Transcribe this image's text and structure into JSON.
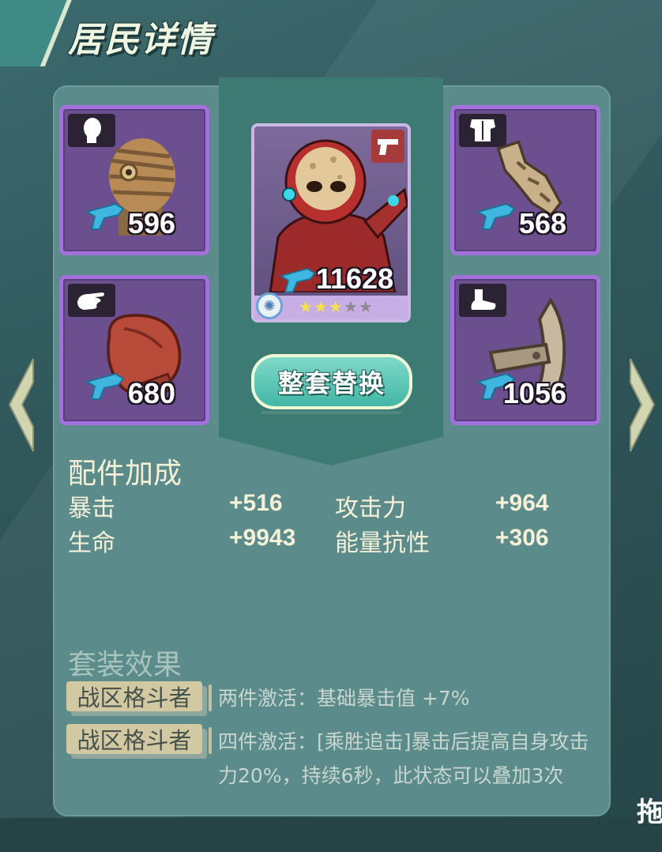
{
  "header": {
    "title": "居民详情"
  },
  "equipment": {
    "head": {
      "type_icon": "head-silhouette-icon",
      "item": "bandaged-mask-helmet",
      "power": "596"
    },
    "body": {
      "type_icon": "torso-icon",
      "item": "segmented-bone-armor",
      "power": "568"
    },
    "hand": {
      "type_icon": "hand-icon",
      "item": "red-boxing-glove",
      "power": "680"
    },
    "foot": {
      "type_icon": "foot-icon",
      "item": "iron-leg-guard",
      "power": "1056"
    }
  },
  "hero": {
    "power": "11628",
    "class_icon": "pistol-icon",
    "stars_filled": 3,
    "stars_total": 5
  },
  "replace_button": {
    "label": "整套替换"
  },
  "bonus": {
    "title": "配件加成",
    "stats": [
      {
        "name": "暴击",
        "value": "+516"
      },
      {
        "name": "攻击力",
        "value": "+964"
      },
      {
        "name": "生命",
        "value": "+9943"
      },
      {
        "name": "能量抗性",
        "value": "+306"
      }
    ]
  },
  "set_effects": {
    "title": "套装效果",
    "items": [
      {
        "set_name": "战区格斗者",
        "effect": "两件激活：基础暴击值 +7%"
      },
      {
        "set_name": "战区格斗者",
        "effect": "四件激活：[乘胜追击]暴击后提高自身攻击力20%，持续6秒，此状态可以叠加3次"
      }
    ]
  },
  "drag_hint": "拖",
  "colors": {
    "slot_border": "#a371dc",
    "slot_fill": "#6b4f8f",
    "button": "#43b7a6",
    "panel": "#5b8b8b",
    "star": "#f7e04a"
  }
}
